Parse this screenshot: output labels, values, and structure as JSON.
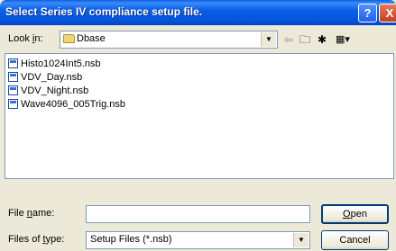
{
  "window": {
    "title": "Select Series IV compliance setup file.",
    "help_icon": "?",
    "close_icon": "X"
  },
  "toolbar": {
    "lookin_prefix": "Look ",
    "lookin_key": "i",
    "lookin_suffix": "n:",
    "lookin_value": "Dbase",
    "icons": {
      "back": "back-arrow-icon",
      "up": "up-folder-icon",
      "new_folder": "new-folder-icon",
      "views": "views-menu-icon"
    }
  },
  "files": [
    "Histo1024Int5.nsb",
    "VDV_Day.nsb",
    "VDV_Night.nsb",
    "Wave4096_005Trig.nsb"
  ],
  "form": {
    "filename_prefix": "File ",
    "filename_key": "n",
    "filename_suffix": "ame:",
    "filename_value": "",
    "filetype_prefix": "Files of ",
    "filetype_key": "t",
    "filetype_suffix": "ype:",
    "filetype_value": "Setup Files (*.nsb)"
  },
  "buttons": {
    "open_key": "O",
    "open_rest": "pen",
    "cancel": "Cancel"
  }
}
